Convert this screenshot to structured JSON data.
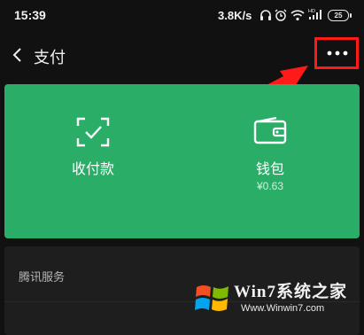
{
  "status_bar": {
    "time": "15:39",
    "net_speed": "3.8K/s",
    "battery": "25",
    "icons": [
      "headphones-icon",
      "alarm-icon",
      "wifi-icon",
      "hd-signal-icon",
      "battery-icon"
    ]
  },
  "header": {
    "back_icon": "chevron-left-icon",
    "title": "支付",
    "more_icon": "more-horizontal-icon"
  },
  "pay_card": {
    "color": "#2aae67",
    "receive": {
      "label": "收付款",
      "icon": "scan-qr-icon"
    },
    "wallet": {
      "label": "钱包",
      "balance": "¥0.63",
      "icon": "wallet-icon"
    }
  },
  "services": {
    "title": "腾讯服务"
  },
  "annotation": {
    "highlight_color": "#ff1a1a"
  },
  "watermark": {
    "text": "Win7系统之家",
    "url": "Www.Winwin7.com"
  }
}
